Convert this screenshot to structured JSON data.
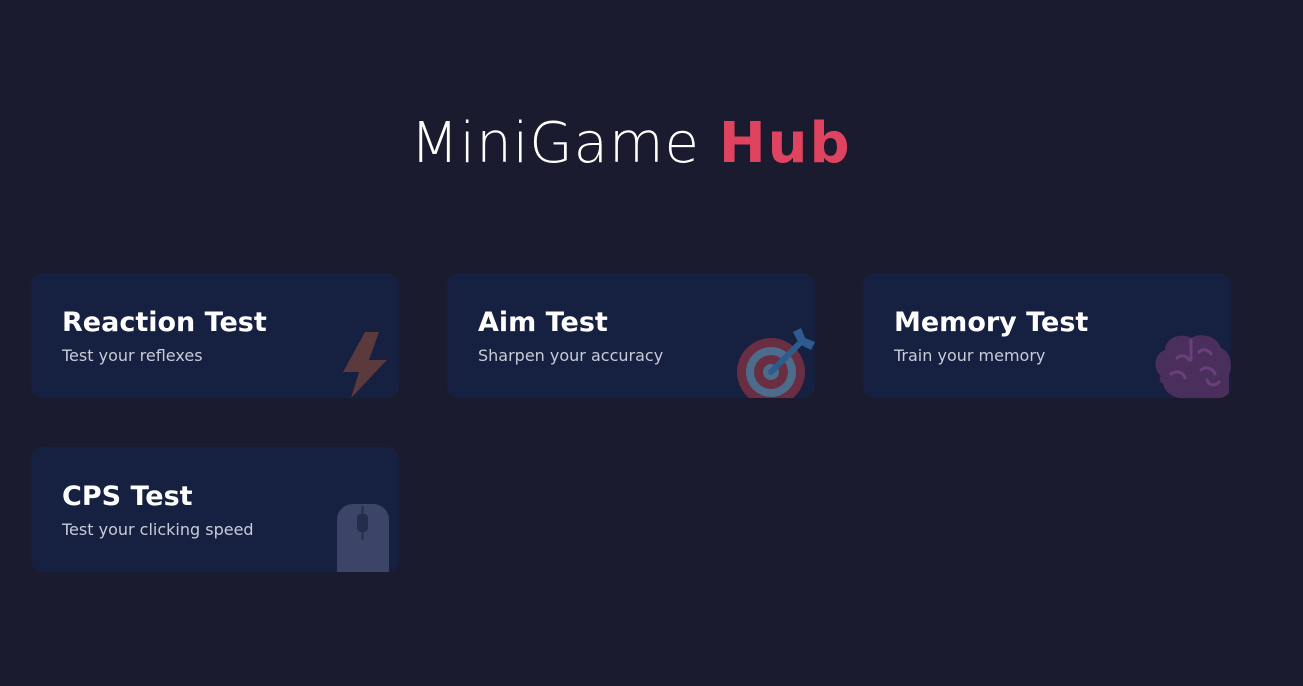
{
  "header": {
    "title_main": "MiniGame",
    "title_accent": "Hub"
  },
  "colors": {
    "background": "#1b1b2f",
    "card": "#162040",
    "accent": "#e0435f",
    "description_text": "#c9ccd8"
  },
  "games": [
    {
      "title": "Reaction Test",
      "description": "Test your reflexes",
      "icon": "lightning-bolt-icon"
    },
    {
      "title": "Aim Test",
      "description": "Sharpen your accuracy",
      "icon": "target-dart-icon"
    },
    {
      "title": "Memory Test",
      "description": "Train your memory",
      "icon": "brain-icon"
    },
    {
      "title": "CPS Test",
      "description": "Test your clicking speed",
      "icon": "mouse-icon"
    }
  ]
}
